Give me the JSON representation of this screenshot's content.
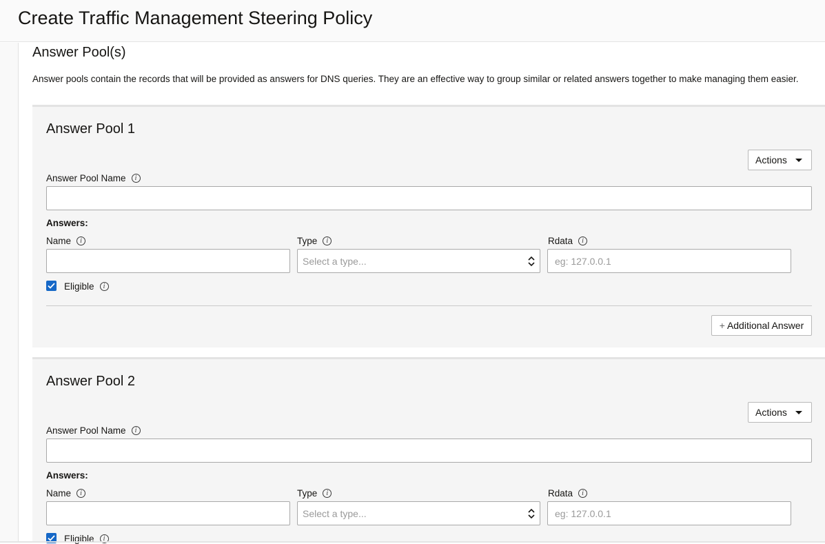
{
  "header": {
    "title": "Create Traffic Management Steering Policy"
  },
  "section": {
    "title": "Answer Pool(s)",
    "description": "Answer pools contain the records that will be provided as answers for DNS queries. They are an effective way to group similar or related answers together to make managing them easier."
  },
  "pools": [
    {
      "title": "Answer Pool 1",
      "actions_label": "Actions",
      "pool_name_label": "Answer Pool Name",
      "pool_name_value": "",
      "answers_label": "Answers:",
      "name_label": "Name",
      "name_value": "",
      "type_label": "Type",
      "type_placeholder": "Select a type...",
      "rdata_label": "Rdata",
      "rdata_placeholder": "eg: 127.0.0.1",
      "eligible_label": "Eligible",
      "eligible_checked": true,
      "add_answer_label": "Additional Answer"
    },
    {
      "title": "Answer Pool 2",
      "actions_label": "Actions",
      "pool_name_label": "Answer Pool Name",
      "pool_name_value": "",
      "answers_label": "Answers:",
      "name_label": "Name",
      "name_value": "",
      "type_label": "Type",
      "type_placeholder": "Select a type...",
      "rdata_label": "Rdata",
      "rdata_placeholder": "eg: 127.0.0.1",
      "eligible_label": "Eligible",
      "eligible_checked": true
    }
  ],
  "icons": {
    "info": "info-icon",
    "caret": "caret-down-icon",
    "check": "check-icon",
    "plus": "plus-icon",
    "select": "select-arrows-icon"
  },
  "colors": {
    "accent": "#1668c7",
    "pool_bg": "#f5f5f5",
    "border": "#a9a9a9"
  }
}
